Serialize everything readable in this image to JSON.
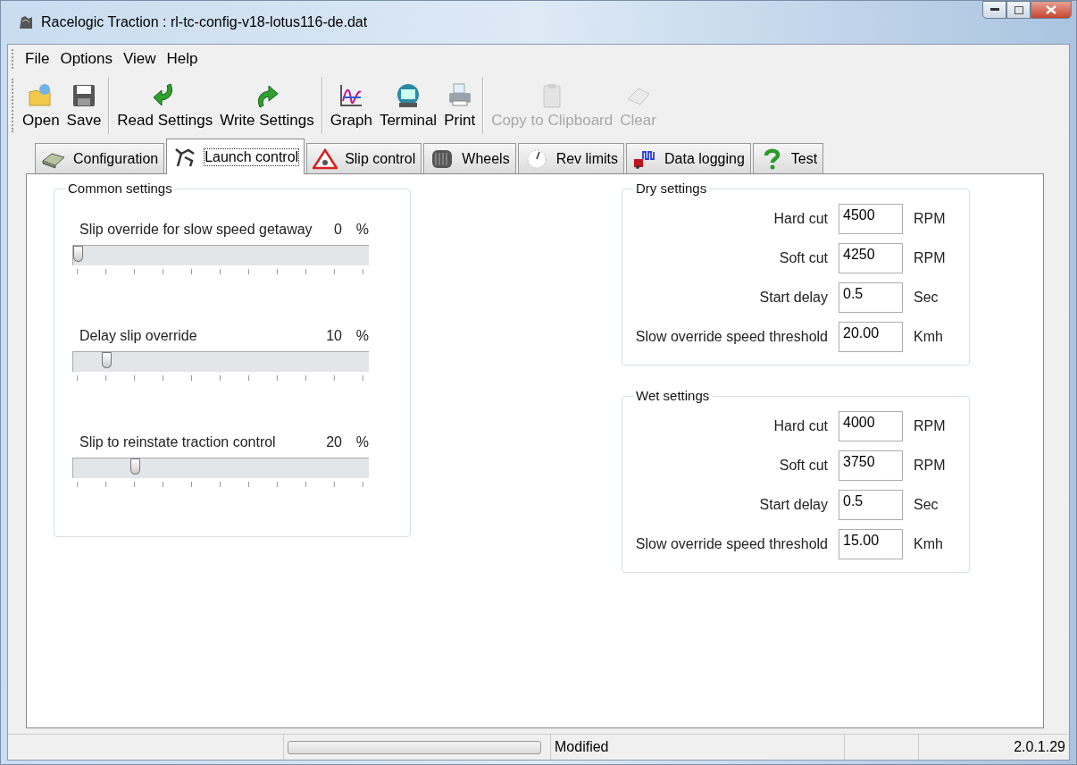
{
  "window": {
    "title": "Racelogic Traction : rl-tc-config-v18-lotus116-de.dat"
  },
  "menu": [
    "File",
    "Options",
    "View",
    "Help"
  ],
  "toolbar": [
    {
      "label": "Open",
      "disabled": false
    },
    {
      "label": "Save",
      "disabled": false
    },
    {
      "label": "Read Settings",
      "disabled": false
    },
    {
      "label": "Write Settings",
      "disabled": false
    },
    {
      "label": "Graph",
      "disabled": false
    },
    {
      "label": "Terminal",
      "disabled": false
    },
    {
      "label": "Print",
      "disabled": false
    },
    {
      "label": "Copy to Clipboard",
      "disabled": true
    },
    {
      "label": "Clear",
      "disabled": true
    }
  ],
  "tabs": [
    {
      "label": "Configuration",
      "selected": false
    },
    {
      "label": "Launch control",
      "selected": true
    },
    {
      "label": "Slip control",
      "selected": false
    },
    {
      "label": "Wheels",
      "selected": false
    },
    {
      "label": "Rev limits",
      "selected": false
    },
    {
      "label": "Data logging",
      "selected": false
    },
    {
      "label": "Test",
      "selected": false
    }
  ],
  "common_settings": {
    "title": "Common settings",
    "sliders": [
      {
        "label": "Slip override for slow speed getaway",
        "value": "0",
        "unit": "%",
        "level": 0
      },
      {
        "label": "Delay slip override",
        "value": "10",
        "unit": "%",
        "level": 0.1
      },
      {
        "label": "Slip to reinstate traction control",
        "value": "20",
        "unit": "%",
        "level": 0.2
      }
    ]
  },
  "groups": [
    {
      "title": "Dry settings",
      "fields": [
        {
          "label": "Hard cut",
          "value": "4500",
          "unit": "RPM"
        },
        {
          "label": "Soft cut",
          "value": "4250",
          "unit": "RPM"
        },
        {
          "label": "Start delay",
          "value": "0.5",
          "unit": "Sec"
        },
        {
          "label": "Slow override speed threshold",
          "value": "20.00",
          "unit": "Kmh"
        }
      ]
    },
    {
      "title": "Wet settings",
      "fields": [
        {
          "label": "Hard cut",
          "value": "4000",
          "unit": "RPM"
        },
        {
          "label": "Soft cut",
          "value": "3750",
          "unit": "RPM"
        },
        {
          "label": "Start delay",
          "value": "0.5",
          "unit": "Sec"
        },
        {
          "label": "Slow override speed threshold",
          "value": "15.00",
          "unit": "Kmh"
        }
      ]
    }
  ],
  "status_bar": {
    "progress": {
      "level": 0
    },
    "status": "Modified",
    "version": "2.0.1.29"
  }
}
